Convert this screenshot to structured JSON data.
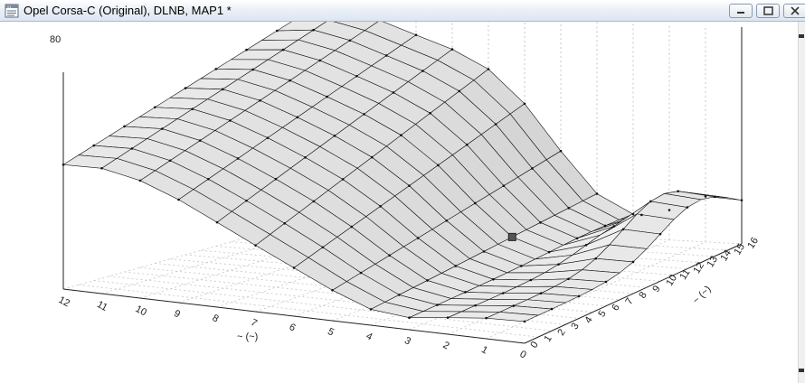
{
  "window": {
    "title": "Opel Corsa-C (Original), DLNB, MAP1 *",
    "icon": "map-document-icon",
    "controls": {
      "minimize": "minimize-icon",
      "maximize": "maximize-icon",
      "close": "close-icon"
    }
  },
  "chart_data": {
    "type": "surface",
    "z_top_label": "80",
    "x_axis_label": "~ (~)",
    "y_axis_label": "~ (~)",
    "x_ticks": [
      "12",
      "11",
      "10",
      "9",
      "8",
      "7",
      "6",
      "5",
      "4",
      "3",
      "2",
      "1",
      "0"
    ],
    "y_ticks": [
      "0",
      "1",
      "2",
      "3",
      "4",
      "5",
      "6",
      "7",
      "8",
      "9",
      "10",
      "11",
      "12",
      "13",
      "14",
      "15",
      "16"
    ],
    "z_range": [
      0,
      80
    ],
    "grid": true,
    "surface_color": "#e6e6e6",
    "line_color": "#111111"
  }
}
